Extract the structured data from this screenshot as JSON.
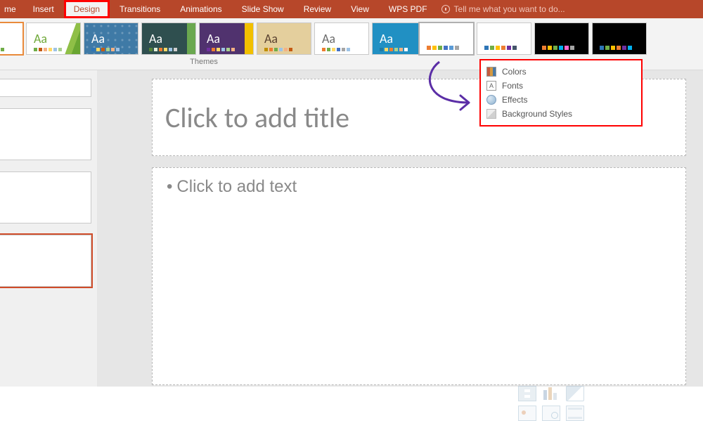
{
  "ribbon": {
    "tabs": [
      "me",
      "Insert",
      "Design",
      "Transitions",
      "Animations",
      "Slide Show",
      "Review",
      "View",
      "WPS PDF"
    ],
    "active_tab_index": 2,
    "tellme_placeholder": "Tell me what you want to do..."
  },
  "themes": {
    "label": "Themes",
    "items": [
      {
        "aa_color": "#6b6b6b",
        "bg": "#ffffff",
        "palette": [
          "#4472c4",
          "#ed7d31",
          "#a5a5a5",
          "#ffc000",
          "#5b9bd5",
          "#70ad47"
        ],
        "selected": true
      },
      {
        "aa_color": "#6fa838",
        "bg": "#ffffff",
        "palette": [
          "#70ad47",
          "#c55a11",
          "#f4b183",
          "#ffd966",
          "#9dc3e6",
          "#a9d08e"
        ],
        "slanted": true
      },
      {
        "aa_color": "#ffffff",
        "bg": "#3f7aa6",
        "palette": [
          "#2e75b6",
          "#ffd966",
          "#c55a11",
          "#a9d08e",
          "#f4b183",
          "#9dc3e6"
        ],
        "pattern": "hex"
      },
      {
        "aa_color": "#ffffff",
        "bg": "#2f4f4f",
        "palette": [
          "#548235",
          "#e2f0d9",
          "#ed7d31",
          "#ffd966",
          "#9dc3e6",
          "#d0cece"
        ],
        "side": "#6aa84f"
      },
      {
        "aa_color": "#ffffff",
        "bg": "#50326e",
        "palette": [
          "#7030a0",
          "#ed7d31",
          "#ffd966",
          "#9dc3e6",
          "#a9d18e",
          "#f4b183"
        ],
        "side": "#f2c000"
      },
      {
        "aa_color": "#5a4230",
        "bg": "#e4cf9d",
        "palette": [
          "#bf8f00",
          "#ed7d31",
          "#70ad47",
          "#9dc3e6",
          "#f4b183",
          "#c55a11"
        ]
      },
      {
        "aa_color": "#6b6b6b",
        "bg": "#ffffff",
        "palette": [
          "#ed7d31",
          "#70ad47",
          "#ffd966",
          "#4472c4",
          "#a5a5a5",
          "#9dc3e6"
        ]
      },
      {
        "aa_color": "#ffffff",
        "bg": "#2190c3",
        "palette": [
          "#1f7aa5",
          "#ffd966",
          "#ed7d31",
          "#a9d18e",
          "#f4b183",
          "#ffffff"
        ]
      }
    ]
  },
  "variants": {
    "items": [
      {
        "bg": "#ffffff",
        "palette": [
          "#ed7d31",
          "#ffc000",
          "#70ad47",
          "#4472c4",
          "#5b9bd5",
          "#a5a5a5"
        ],
        "selected": true
      },
      {
        "bg": "#ffffff",
        "palette": [
          "#2e75b6",
          "#70ad47",
          "#ffc000",
          "#ed7d31",
          "#7030a0",
          "#44546a"
        ]
      },
      {
        "bg": "#000000",
        "palette": [
          "#ed7d31",
          "#ffc000",
          "#70ad47",
          "#00b0f0",
          "#ff66cc",
          "#a5a5a5"
        ]
      },
      {
        "bg": "#000000",
        "palette": [
          "#2e75b6",
          "#70ad47",
          "#ffc000",
          "#ed7d31",
          "#7030a0",
          "#00b0f0"
        ]
      }
    ],
    "dropdown": {
      "colors_label": "Colors",
      "fonts_label": "Fonts",
      "effects_label": "Effects",
      "bg_label": "Background Styles"
    }
  },
  "slide": {
    "title_placeholder": "Click to add title",
    "content_placeholder": "Click to add text"
  }
}
